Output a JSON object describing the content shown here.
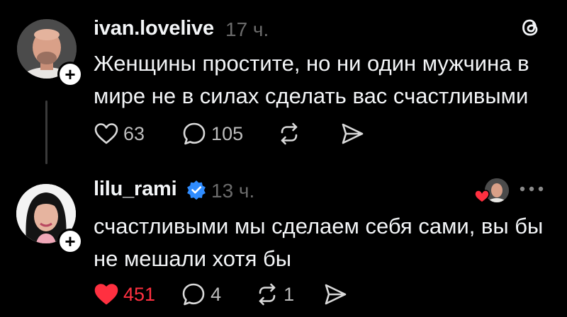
{
  "post1": {
    "username": "ivan.lovelive",
    "time": "17 ч.",
    "text_line1": "Женщины простите, но ни один мужчина в",
    "text_line2": "мире  не в силах сделать вас счастливыми",
    "likes": "63",
    "replies": "105"
  },
  "post2": {
    "username": "lilu_rami",
    "time": "13 ч.",
    "text_line1": "счастливыми мы сделаем себя сами, вы бы",
    "text_line2": "не мешали хотя бы",
    "likes": "451",
    "replies": "4",
    "reposts": "1"
  },
  "colors": {
    "background": "#000000",
    "text": "#f3f5f7",
    "muted": "#6b6b6b",
    "like_active": "#ff3040",
    "verified": "#2f8cff"
  },
  "icons": [
    "threads-logo-icon",
    "heart-icon",
    "comment-icon",
    "repost-icon",
    "share-icon",
    "verified-icon",
    "plus-icon",
    "more-icon"
  ]
}
